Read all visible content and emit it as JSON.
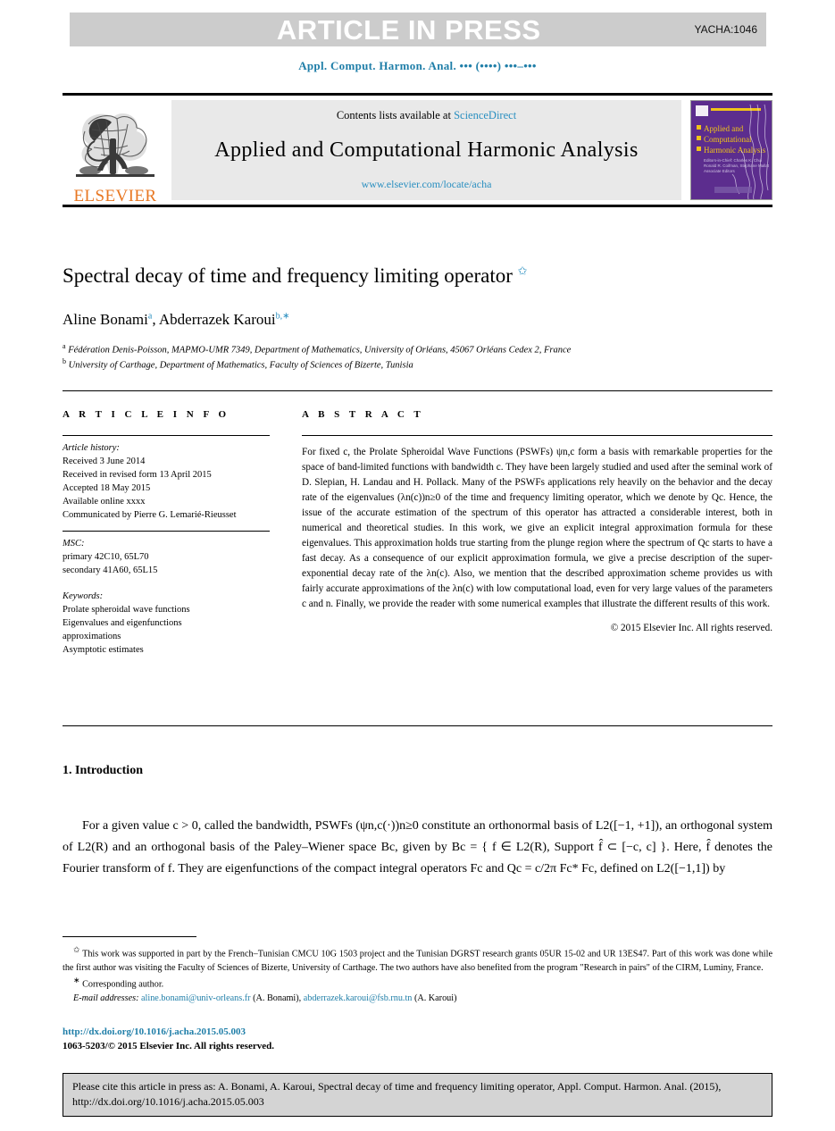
{
  "banner": {
    "label": "ARTICLE IN PRESS",
    "code": "YACHA:1046",
    "bg_color": "#cccccc"
  },
  "running_head": "Appl. Comput. Harmon. Anal. ••• (••••) •••–•••",
  "masthead": {
    "contents_prefix": "Contents lists available at ",
    "sciencedirect": "ScienceDirect",
    "journal_name": "Applied and Computational Harmonic Analysis",
    "journal_url": "www.elsevier.com/locate/acha",
    "publisher_wordmark": "ELSEVIER",
    "publisher_color": "#E87722",
    "link_color": "#2a8fc0",
    "cover": {
      "title_line1": "Applied and",
      "title_line2": "Computational",
      "title_line3": "Harmonic Analysis",
      "bg_color": "#5c2d8e",
      "title_color": "#f0c419"
    }
  },
  "article": {
    "title": "Spectral decay of time and frequency limiting operator",
    "title_footnote_mark": "✩",
    "authors_html": "Aline Bonami<sup class=\"aff-mark\">a</sup>, Abderrazek Karoui<sup class=\"aff-mark\">b,∗</sup>",
    "authors_plain": "Aline Bonami a, Abderrazek Karoui b,∗",
    "affiliations": [
      {
        "mark": "a",
        "text": "Fédération Denis-Poisson, MAPMO-UMR 7349, Department of Mathematics, University of Orléans, 45067 Orléans Cedex 2, France"
      },
      {
        "mark": "b",
        "text": "University of Carthage, Department of Mathematics, Faculty of Sciences of Bizerte, Tunisia"
      }
    ]
  },
  "info": {
    "heading": "A R T I C L E   I N F O",
    "history_label": "Article history:",
    "history": [
      "Received 3 June 2014",
      "Received in revised form 13 April 2015",
      "Accepted 18 May 2015",
      "Available online xxxx",
      "Communicated by Pierre G. Lemarié-Rieusset"
    ],
    "msc_label": "MSC:",
    "msc": [
      "primary 42C10, 65L70",
      "secondary 41A60, 65L15"
    ],
    "keywords_label": "Keywords:",
    "keywords": [
      "Prolate spheroidal wave functions",
      "Eigenvalues and eigenfunctions",
      "approximations",
      "Asymptotic estimates"
    ]
  },
  "abstract": {
    "heading": "A B S T R A C T",
    "text": "For fixed c, the Prolate Spheroidal Wave Functions (PSWFs) ψn,c form a basis with remarkable properties for the space of band-limited functions with bandwidth c. They have been largely studied and used after the seminal work of D. Slepian, H. Landau and H. Pollack. Many of the PSWFs applications rely heavily on the behavior and the decay rate of the eigenvalues (λn(c))n≥0 of the time and frequency limiting operator, which we denote by Qc. Hence, the issue of the accurate estimation of the spectrum of this operator has attracted a considerable interest, both in numerical and theoretical studies. In this work, we give an explicit integral approximation formula for these eigenvalues. This approximation holds true starting from the plunge region where the spectrum of Qc starts to have a fast decay. As a consequence of our explicit approximation formula, we give a precise description of the super-exponential decay rate of the λn(c). Also, we mention that the described approximation scheme provides us with fairly accurate approximations of the λn(c) with low computational load, even for very large values of the parameters c and n. Finally, we provide the reader with some numerical examples that illustrate the different results of this work.",
    "copyright": "© 2015 Elsevier Inc. All rights reserved."
  },
  "introduction": {
    "section_number": "1.",
    "section_title": "1. Introduction",
    "paragraph": "For a given value c > 0, called the bandwidth, PSWFs (ψn,c(·))n≥0 constitute an orthonormal basis of L2([−1, +1]), an orthogonal system of L2(R) and an orthogonal basis of the Paley–Wiener space Bc, given by Bc = { f ∈ L2(R), Support f̂ ⊂ [−c, c] }. Here, f̂ denotes the Fourier transform of f. They are eigenfunctions of the compact integral operators Fc and Qc = c/2π Fc* Fc, defined on L2([−1,1]) by"
  },
  "footnotes": {
    "funding_mark": "✩",
    "funding": "This work was supported in part by the French–Tunisian CMCU 10G 1503 project and the Tunisian DGRST research grants 05UR 15-02 and UR 13ES47. Part of this work was done while the first author was visiting the Faculty of Sciences of Bizerte, University of Carthage. The two authors have also benefited from the program \"Research in pairs\" of the CIRM, Luminy, France.",
    "corresponding_mark": "∗",
    "corresponding": "Corresponding author.",
    "email_label": "E-mail addresses:",
    "emails": [
      {
        "address": "aline.bonami@univ-orleans.fr",
        "person": "(A. Bonami)"
      },
      {
        "address": "abderrazek.karoui@fsb.rnu.tn",
        "person": "(A. Karoui)"
      }
    ],
    "link_color": "#1f7ea8"
  },
  "doi": {
    "url": "http://dx.doi.org/10.1016/j.acha.2015.05.003",
    "issn_line": "1063-5203/© 2015 Elsevier Inc. All rights reserved."
  },
  "cite_box": {
    "text": "Please cite this article in press as: A. Bonami, A. Karoui, Spectral decay of time and frequency limiting operator, Appl. Comput. Harmon. Anal. (2015), http://dx.doi.org/10.1016/j.acha.2015.05.003",
    "bg_color": "#d4d4d4"
  }
}
